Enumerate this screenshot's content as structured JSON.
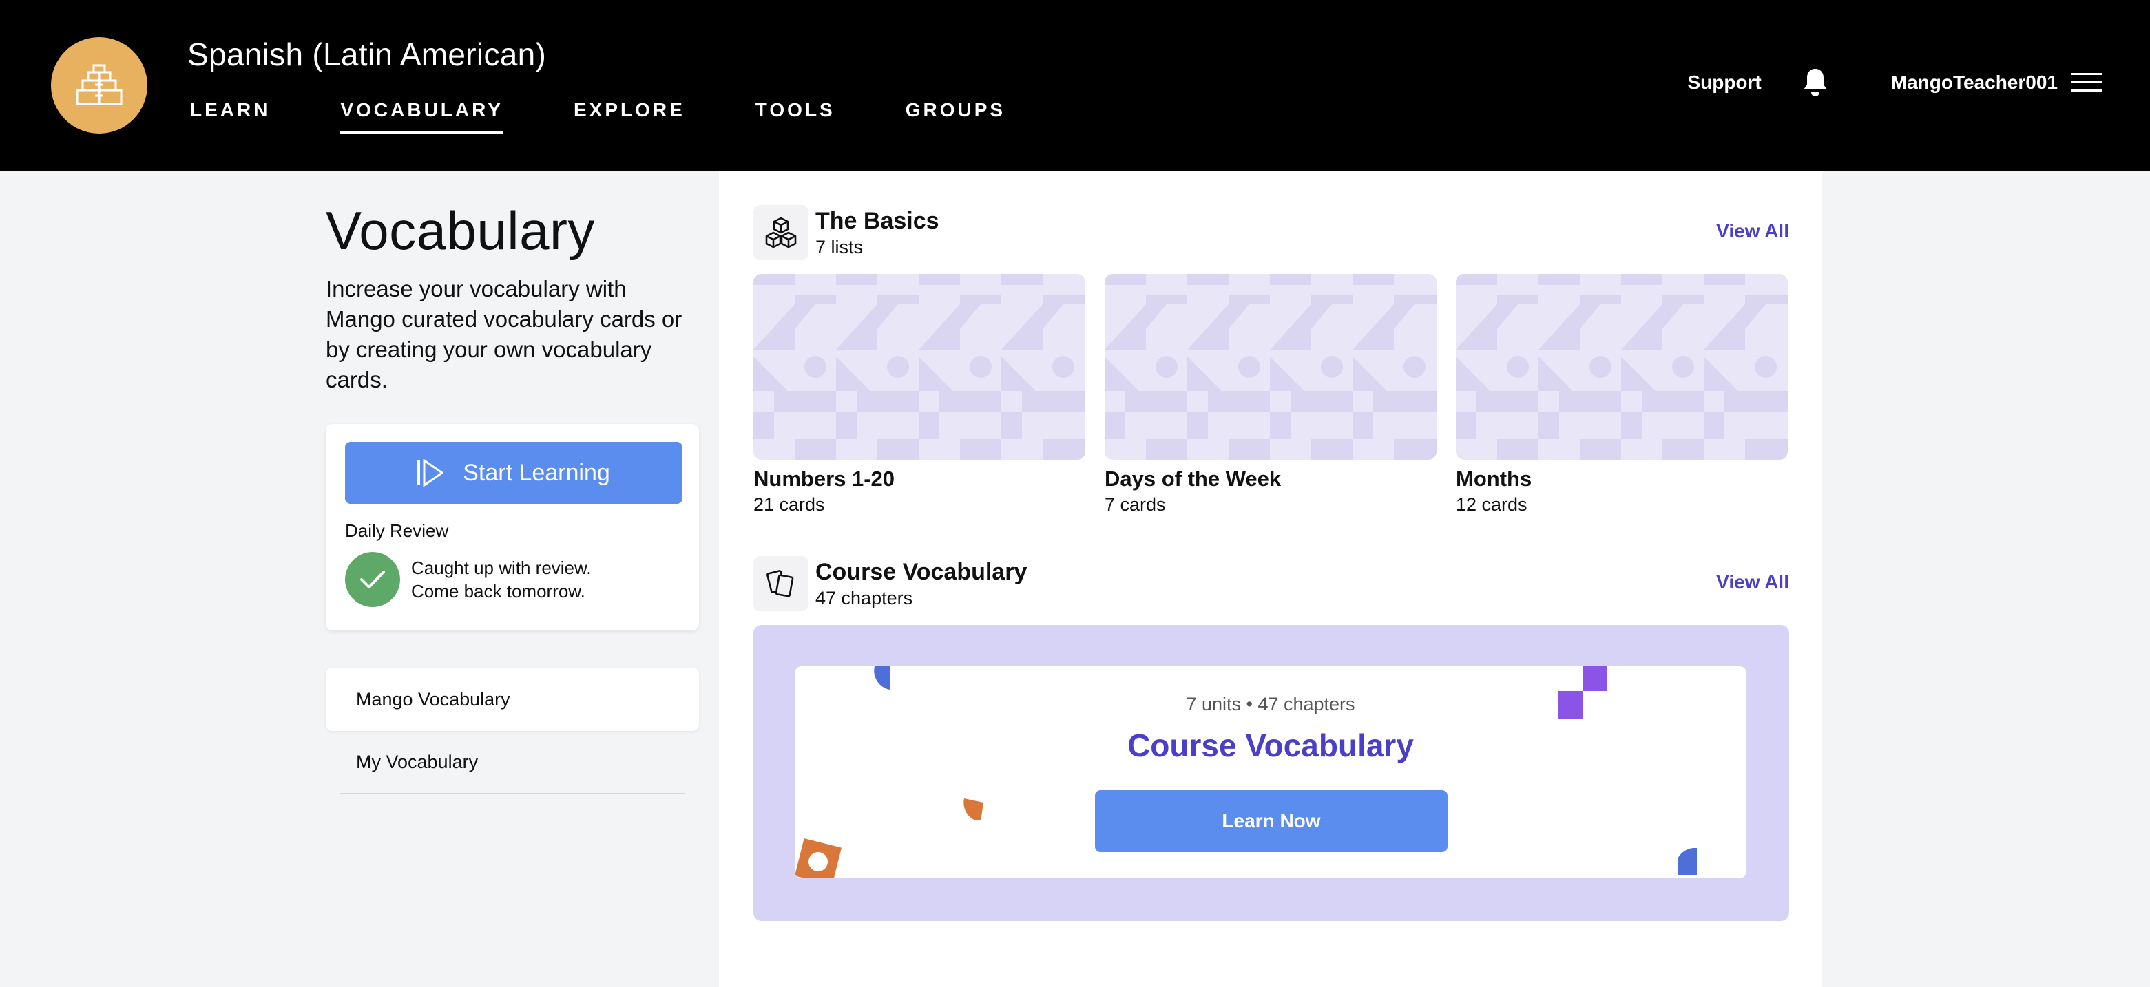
{
  "header": {
    "course_title": "Spanish (Latin American)",
    "nav": [
      "LEARN",
      "VOCABULARY",
      "EXPLORE",
      "TOOLS",
      "GROUPS"
    ],
    "active_nav": "VOCABULARY",
    "support": "Support",
    "username": "MangoTeacher001"
  },
  "sidebar": {
    "title": "Vocabulary",
    "description": "Increase your vocabulary with Mango curated vocabulary cards or by creating your own vocabulary cards.",
    "start_learning": "Start Learning",
    "daily_review_label": "Daily Review",
    "review_status_line1": "Caught up with review.",
    "review_status_line2": "Come back tomorrow.",
    "nav_items": [
      "Mango Vocabulary",
      "My Vocabulary"
    ]
  },
  "basics": {
    "title": "The Basics",
    "subtitle": "7 lists",
    "view_all": "View All",
    "lists": [
      {
        "name": "Numbers 1-20",
        "count": "21 cards"
      },
      {
        "name": "Days of the Week",
        "count": "7 cards"
      },
      {
        "name": "Months",
        "count": "12 cards"
      }
    ]
  },
  "course_vocab": {
    "title": "Course Vocabulary",
    "subtitle": "47 chapters",
    "view_all": "View All",
    "banner_meta": "7 units • 47 chapters",
    "banner_title": "Course Vocabulary",
    "learn_now": "Learn Now"
  },
  "colors": {
    "accent_blue": "#5b8def",
    "brand_purple": "#4b3fc9",
    "logo_gold": "#e8b15f",
    "success_green": "#5fa968"
  },
  "icons": {
    "logo": "pyramid-icon",
    "bell": "bell-icon",
    "menu": "hamburger-icon",
    "start": "play-icon",
    "check": "check-icon",
    "basics": "cubes-icon",
    "course": "cards-icon"
  }
}
